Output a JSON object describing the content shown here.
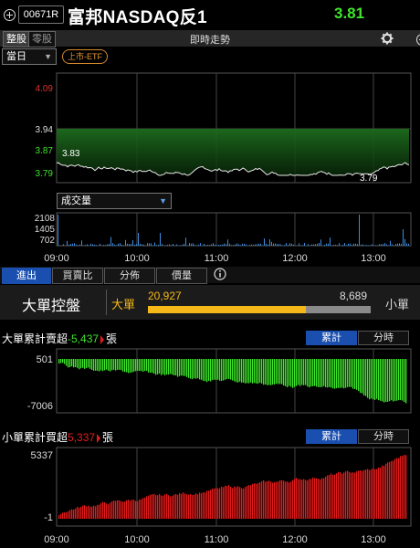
{
  "header": {
    "stock_code": "00671R",
    "stock_name": "富邦NASDAQ反1",
    "price": "3.81"
  },
  "subbar": {
    "seg_whole": "整股",
    "seg_odd": "零股",
    "title": "即時走勢"
  },
  "controls": {
    "period": "當日",
    "market_tag": "上市-ETF",
    "indicator": "成交量"
  },
  "price_axis": {
    "labels": [
      {
        "text": "4.09",
        "color": "#e03030"
      },
      {
        "text": "3.94",
        "color": "#dddddd"
      },
      {
        "text": "3.87",
        "color": "#3ee62a"
      },
      {
        "text": "3.79",
        "color": "#3ee62a"
      }
    ],
    "open_label": "3.83",
    "low_label": "3.79"
  },
  "volume_axis": {
    "labels": [
      "2108",
      "1405",
      "702"
    ]
  },
  "time_axis": {
    "labels": [
      "09:00",
      "10:00",
      "11:00",
      "12:00",
      "13:00"
    ]
  },
  "analysis_tabs": [
    "進出",
    "買賣比",
    "分佈",
    "價量"
  ],
  "big_vs_small": {
    "title": "大單控盤",
    "big_label": "大單",
    "small_label": "小單",
    "big_value": "20,927",
    "small_value": "8,689",
    "big_ratio": 0.707
  },
  "big_cumulative": {
    "prefix": "大單累計賣超",
    "value": "-5,437",
    "unit": "張",
    "value_color": "#3ee62a",
    "btn_cumulative": "累計",
    "btn_period": "分時",
    "axis_top": "501",
    "axis_bottom": "-7006"
  },
  "small_cumulative": {
    "prefix": "小單累計買超",
    "value": "5,337",
    "unit": "張",
    "value_color": "#e51b1b",
    "btn_cumulative": "累計",
    "btn_period": "分時",
    "axis_top": "5337",
    "axis_bottom": "-1"
  },
  "colors": {
    "up": "#e51b1b",
    "down": "#3ee62a",
    "accent": "#1a4fb0",
    "big_bar": "#f5b818"
  }
}
